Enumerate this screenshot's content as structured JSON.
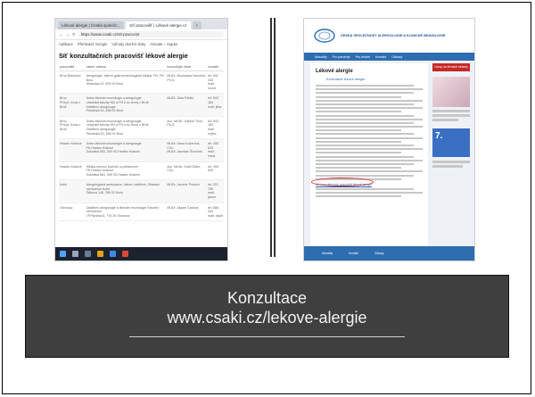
{
  "left_screenshot": {
    "tabs": [
      "Lékové alergie | Česká společn...",
      "Síť pracovišť | Lékové alergie.cz",
      "+"
    ],
    "address": "https://www.csaki.cz/sit-pracovist",
    "bookmarks": [
      "Aplikace",
      "Přehledač Google",
      "Výhody dnešní doby",
      "Oxicate – regula"
    ],
    "heading": "Síť konzultačních pracovišť lékové alergie",
    "columns": [
      "pracoviště",
      "název, adresa",
      "konzultující lékař",
      "kontakt"
    ],
    "rows": [
      [
        "Brno Bohunice",
        "Alergologie, Interní gastroenterologická klinika, FN, FN Brno\nJihlavská 20, 625 00 Brno",
        "MUDr. Bronislava Novotná, Ph.D.",
        "tel: 532 233\nmail: novot"
      ],
      [
        "Brno\nPřís.pr. Anny v Brně",
        "Ústav klinické imunologie a alergologie\nLékařské fakulty MU a FN u sv. Anny v Brně\nOddělení alergologie\nPekařská 53, 656 91 Brno",
        "MUDr. Jitka Petáki",
        "tel: 543 183\nmail: jitka."
      ],
      [
        "Brno\nPřís.pr. Anny v Brně",
        "Ústav klinické imunologie a alergologie\nLékařské fakulty MU a FN u sv. Anny v Brně\nOddělení alergologie\nPekařská 53, 656 91 Brno",
        "doc. MUDr. Vojtěch Thon, Ph.D.",
        "tel: 543 183\nmail: vojtec"
      ],
      [
        "Hradec Králové",
        "Ústav klinické imunologie a alergologie\nFN Hradec Králové\nSokolská 581, 500 05 Hradec Králové",
        "MUDr. Hana Kučerová, CSc.\nMUDr. Jaroslav Šťovíček",
        "tel: 495 833\nmail: hana."
      ],
      [
        "Hradec Králové",
        "Klinika nemocí kožních a pohlavních\nFN Hradec Králové\nSokolská 581, 500 05 Hradec Králové",
        "doc. MUDr. Karel Ettler, CSc.",
        "tel: 495 833"
      ],
      [
        "Kolín",
        "Alergologická ambulance, Interní oddělení, Oblastní nemocnice Kolín\nŽižkova 146, 280 02 Kolín",
        "MUDr. Jaromír Poutník",
        "tel: 321 756\nmail: jarom"
      ],
      [
        "Olomouc",
        "Oddělení alergologie a klinické imunologie Fakultní nemocnice\nI.P.Pavlova 6, 775 20 Olomouc",
        "MUDr. Alojzie Čadová",
        "tel: 588 443\nmail: alojzi"
      ]
    ]
  },
  "right_screenshot": {
    "org_name": "ČESKÁ SPOLEČNOST ALERGOLOGIE A KLINICKÉ IMUNOLOGIE",
    "nav": [
      "Aktuality",
      "Pro pacienty",
      "Pro lékaře",
      "Kontakt",
      "Odkazy"
    ],
    "page_heading": "Lékové alergie",
    "subheading": "Konzultace lékové alergie",
    "link": "Síť konzultačních pracovišť lékové alergie",
    "side_button": "Vstup na členské stránky",
    "side_number": "7.",
    "footer": [
      "Aktuality",
      "Kontakt",
      "Odkazy"
    ]
  },
  "caption": {
    "title": "Konzultace",
    "url": "www.csaki.cz/lekove-alergie"
  }
}
